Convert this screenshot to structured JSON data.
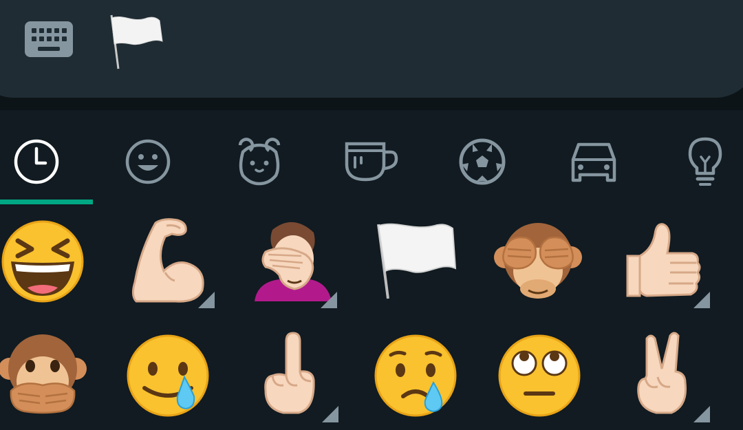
{
  "input_bar": {
    "keyboard_icon": "keyboard-icon",
    "draft_emoji": "white-flag"
  },
  "emoji_tabs": {
    "selected_index": 0,
    "items": [
      {
        "name": "recent",
        "icon": "clock-icon"
      },
      {
        "name": "smileys-people",
        "icon": "smiley-icon"
      },
      {
        "name": "animals-nature",
        "icon": "bear-icon"
      },
      {
        "name": "food-drink",
        "icon": "cup-icon"
      },
      {
        "name": "activity",
        "icon": "soccer-ball-icon"
      },
      {
        "name": "travel-places",
        "icon": "car-icon"
      },
      {
        "name": "objects",
        "icon": "lightbulb-icon"
      }
    ],
    "indicator_color": "#00a884",
    "icon_color": "#8696a0",
    "selected_icon_color": "#ffffff"
  },
  "recent_emojis": [
    {
      "name": "grinning-squinting-face",
      "char": "😆",
      "has_skin_tone_variants": false
    },
    {
      "name": "flexed-biceps",
      "char": "💪",
      "has_skin_tone_variants": true
    },
    {
      "name": "person-facepalming",
      "char": "🤦",
      "has_skin_tone_variants": true
    },
    {
      "name": "white-flag",
      "char": "🏳",
      "has_skin_tone_variants": false
    },
    {
      "name": "see-no-evil-monkey",
      "char": "🙈",
      "has_skin_tone_variants": false
    },
    {
      "name": "thumbs-up",
      "char": "👍",
      "has_skin_tone_variants": true
    },
    {
      "name": "speak-no-evil-monkey",
      "char": "🙊",
      "has_skin_tone_variants": false
    },
    {
      "name": "smiling-face-with-tear",
      "char": "🥲",
      "has_skin_tone_variants": false
    },
    {
      "name": "index-pointing-up",
      "char": "☝",
      "has_skin_tone_variants": true
    },
    {
      "name": "crying-face",
      "char": "😢",
      "has_skin_tone_variants": false
    },
    {
      "name": "face-with-rolling-eyes",
      "char": "🙄",
      "has_skin_tone_variants": false
    },
    {
      "name": "victory-hand",
      "char": "✌",
      "has_skin_tone_variants": true
    }
  ],
  "colors": {
    "background": "#111b21",
    "input_bar": "#1f2c33",
    "accent": "#00a884"
  }
}
